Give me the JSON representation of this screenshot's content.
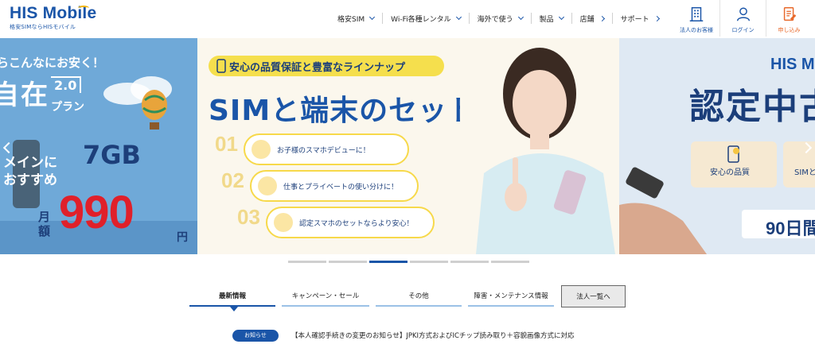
{
  "brand": {
    "logo": "HIS Mobile",
    "tagline": "格安SIMならHISモバイル"
  },
  "nav": {
    "items": [
      {
        "label": "格安SIM",
        "kind": "dropdown"
      },
      {
        "label": "Wi-Fi各種レンタル",
        "kind": "dropdown"
      },
      {
        "label": "海外で使う",
        "kind": "dropdown"
      },
      {
        "label": "製品",
        "kind": "dropdown"
      },
      {
        "label": "店舗",
        "kind": "link"
      },
      {
        "label": "サポート",
        "kind": "link"
      }
    ]
  },
  "header_actions": [
    {
      "label": "法人のお客様",
      "icon": "building-icon"
    },
    {
      "label": "ログイン",
      "icon": "user-icon"
    },
    {
      "label": "申し込み",
      "icon": "application-form-icon"
    }
  ],
  "hero": {
    "left": {
      "top_text": "らこんなにお安く！",
      "plan": "自在",
      "plan_version": "2.0",
      "plan_suffix": "プラン",
      "data": "7GB",
      "recommend": "メインに\nおすすめ",
      "monthly": "月額",
      "price": "990",
      "yen": "円"
    },
    "center": {
      "banner": "安心の品質保証と豊富なラインナップ",
      "title": "SIMと端末のセット",
      "items": [
        {
          "num": "01",
          "text": "お子様のスマホデビューに！"
        },
        {
          "num": "02",
          "text": "仕事とプライベートの使い分けに！"
        },
        {
          "num": "03",
          "text": "認定スマホのセットならより安心！"
        }
      ]
    },
    "right": {
      "brand": "HIS M",
      "title": "認定中古",
      "card1": "安心の品質",
      "card2": "SIMと",
      "days": "90日間"
    },
    "slide_count": 6,
    "active_slide": 2
  },
  "tabs": {
    "items": [
      "最新情報",
      "キャンペーン・セール",
      "その他",
      "障害・メンテナンス情報"
    ],
    "active": 0,
    "corp_button": "法人一覧へ"
  },
  "news": {
    "badge": "お知らせ",
    "text": "【本人確認手続きの変更のお知らせ】JPKI方式およびICチップ読み取り＋容貌画像方式に対応"
  },
  "colors": {
    "brand_blue": "#1a55a8",
    "accent_orange": "#e8692b",
    "price_red": "#e0202a",
    "highlight_yellow": "#f5df4d"
  }
}
